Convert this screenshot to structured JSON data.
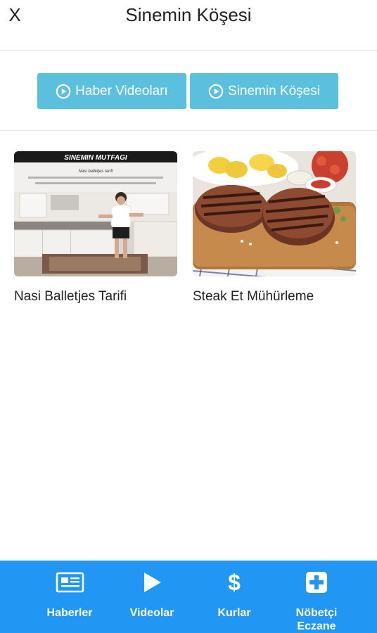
{
  "header": {
    "close_label": "X",
    "title": "Sinemin Köşesi"
  },
  "tabs": [
    {
      "label": "Haber Videoları",
      "icon": "play-circle-icon"
    },
    {
      "label": "Sinemin Köşesi",
      "icon": "play-circle-icon"
    }
  ],
  "videos": [
    {
      "title": "Nasi Balletjes Tarifi",
      "thumbnail_banner": "SINEMIN MUTFAGI",
      "thumbnail_caption": "Nasi balletjes tarifi"
    },
    {
      "title": "Steak Et Mühürleme"
    }
  ],
  "bottom_nav": [
    {
      "label": "Haberler",
      "icon": "newspaper-icon"
    },
    {
      "label": "Videolar",
      "icon": "play-icon"
    },
    {
      "label": "Kurlar",
      "icon": "dollar-icon"
    },
    {
      "label": "Nöbetçi\nEczane",
      "icon": "plus-square-icon"
    }
  ],
  "colors": {
    "tab_button": "#5bc0de",
    "bottom_nav": "#2196f3",
    "text": "#222222"
  }
}
